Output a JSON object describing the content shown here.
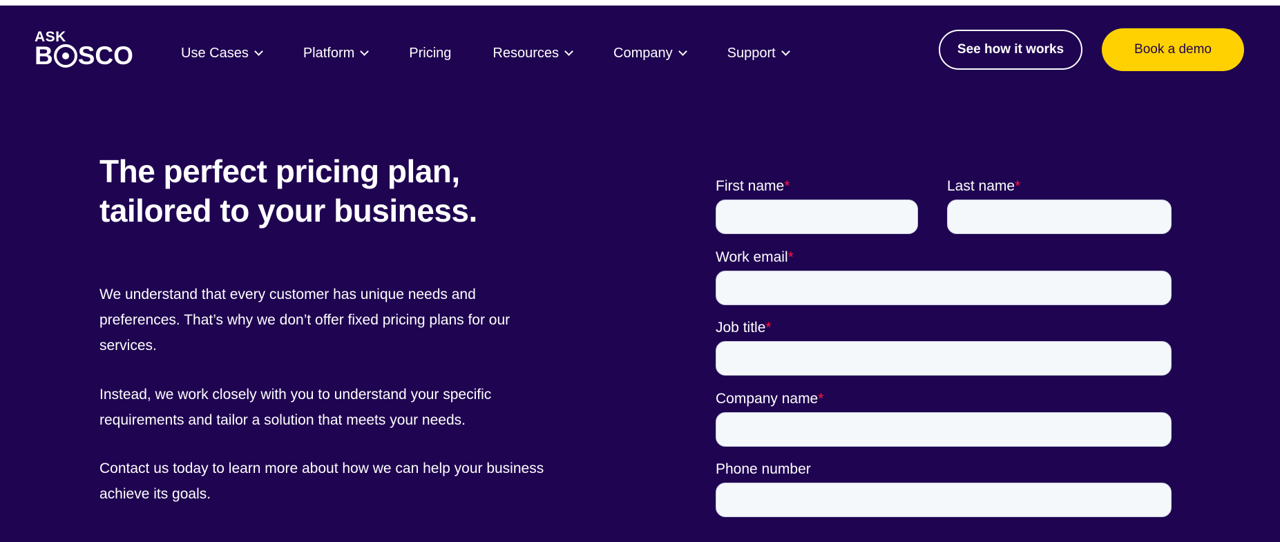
{
  "header": {
    "logo_top": "ASK",
    "logo_bottom_b": "B",
    "logo_bottom_rest": "SCO",
    "nav": [
      {
        "label": "Use Cases",
        "has_dropdown": true
      },
      {
        "label": "Platform",
        "has_dropdown": true
      },
      {
        "label": "Pricing",
        "has_dropdown": false
      },
      {
        "label": "Resources",
        "has_dropdown": true
      },
      {
        "label": "Company",
        "has_dropdown": true
      },
      {
        "label": "Support",
        "has_dropdown": true
      }
    ],
    "see_how_label": "See how it works",
    "book_demo_label": "Book a demo"
  },
  "hero": {
    "headline_line1": "The perfect pricing plan,",
    "headline_line2": "tailored to your business.",
    "paragraph1": "We understand that every customer has unique needs and preferences. That’s why we don’t offer fixed pricing plans for our services.",
    "paragraph2": "Instead, we work closely with you to understand your specific requirements and tailor a solution that meets your needs.",
    "paragraph3": "Contact us today to learn more about how we can help your business achieve its goals."
  },
  "form": {
    "required_mark": "*",
    "first_name_label": "First name",
    "first_name_value": "",
    "last_name_label": "Last name",
    "last_name_value": "",
    "work_email_label": "Work email",
    "work_email_value": "",
    "job_title_label": "Job title",
    "job_title_value": "",
    "company_name_label": "Company name",
    "company_name_value": "",
    "phone_label": "Phone number",
    "phone_value": ""
  },
  "colors": {
    "background": "#1f0451",
    "accent_yellow": "#ffd100",
    "required_red": "#ff1744",
    "input_bg": "#f4f8fa"
  }
}
